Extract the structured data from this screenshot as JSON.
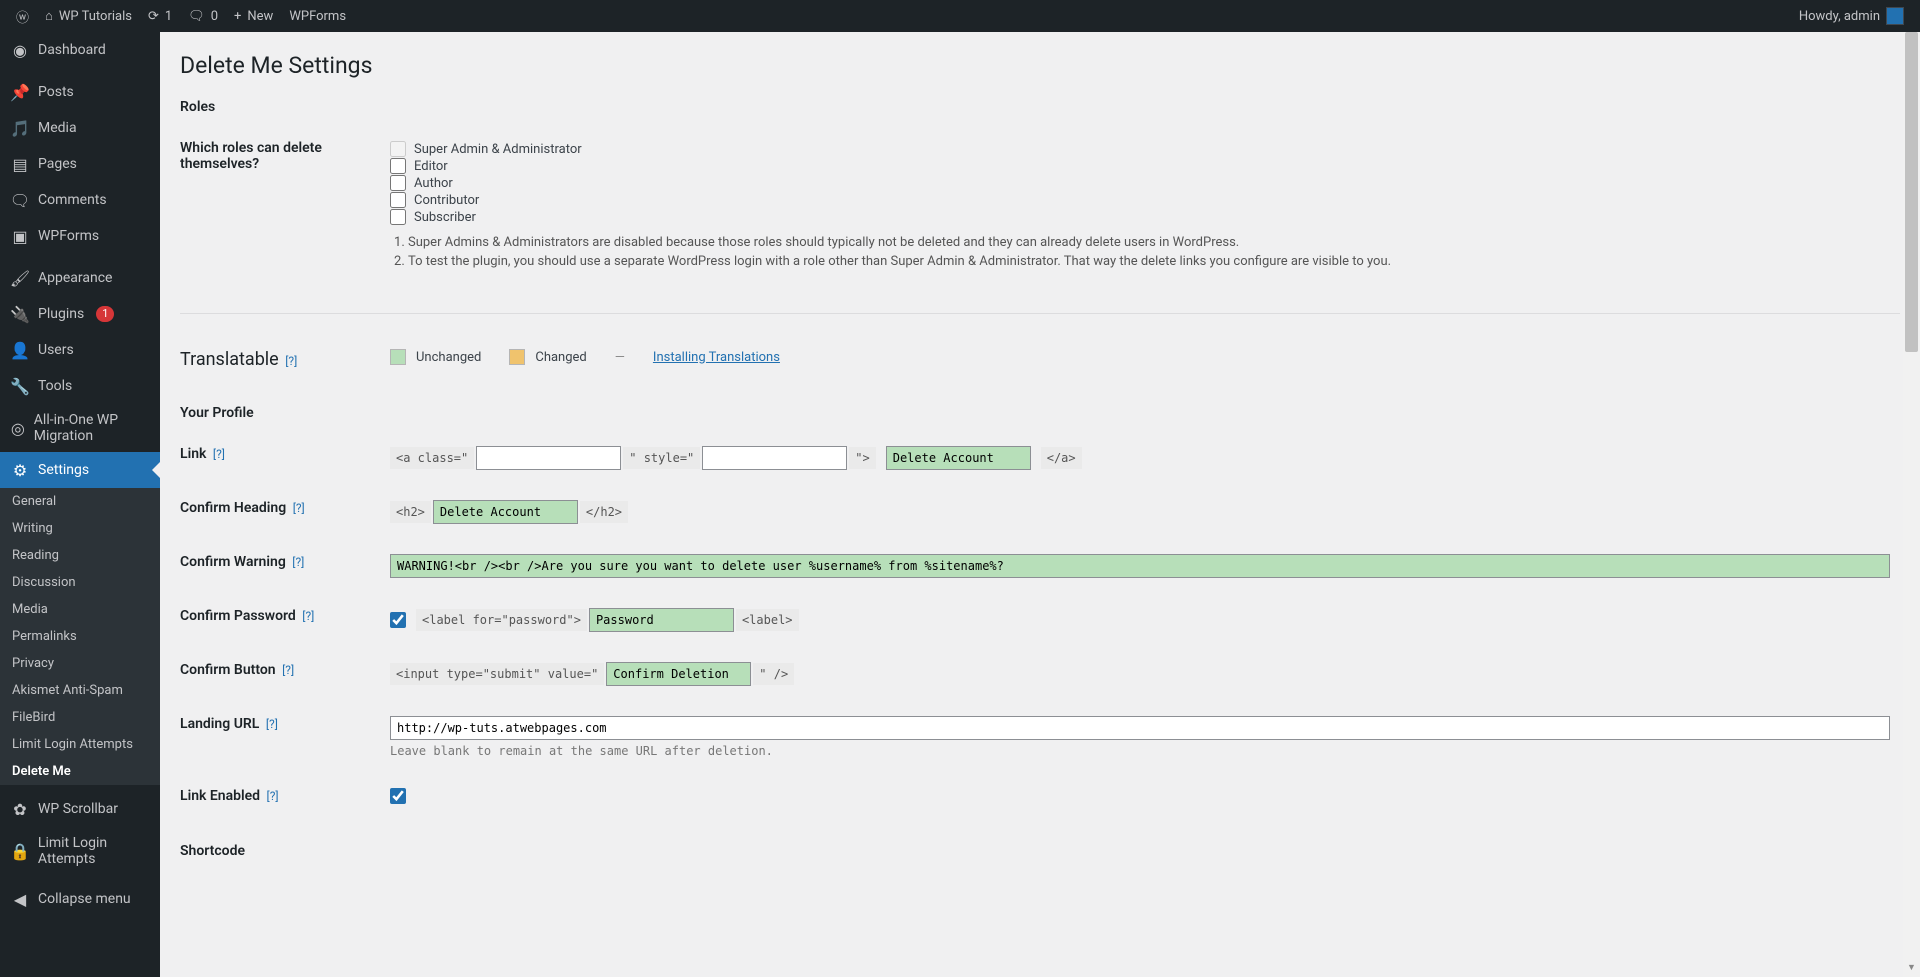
{
  "adminbar": {
    "site": "WP Tutorials",
    "updates": "1",
    "comments": "0",
    "new": "New",
    "wpforms": "WPForms",
    "howdy": "Howdy, admin"
  },
  "sidebar": {
    "dashboard": "Dashboard",
    "posts": "Posts",
    "media": "Media",
    "pages": "Pages",
    "comments": "Comments",
    "wpforms": "WPForms",
    "appearance": "Appearance",
    "plugins": "Plugins",
    "plugins_badge": "1",
    "users": "Users",
    "tools": "Tools",
    "aio": "All-in-One WP Migration",
    "settings": "Settings",
    "sub": {
      "general": "General",
      "writing": "Writing",
      "reading": "Reading",
      "discussion": "Discussion",
      "media": "Media",
      "permalinks": "Permalinks",
      "privacy": "Privacy",
      "akismet": "Akismet Anti-Spam",
      "filebird": "FileBird",
      "lla": "Limit Login Attempts",
      "deleteme": "Delete Me"
    },
    "wpscrollbar": "WP Scrollbar",
    "limitlogin": "Limit Login Attempts",
    "collapse": "Collapse menu"
  },
  "page": {
    "title": "Delete Me Settings"
  },
  "roles": {
    "heading": "Roles",
    "label": "Which roles can delete themselves?",
    "items": [
      "Super Admin & Administrator",
      "Editor",
      "Author",
      "Contributor",
      "Subscriber"
    ],
    "note1": "Super Admins & Administrators are disabled because those roles should typically not be deleted and they can already delete users in WordPress.",
    "note2": "To test the plugin, you should use a separate WordPress login with a role other than Super Admin & Administrator. That way the delete links you configure are visible to you."
  },
  "translatable": {
    "heading": "Translatable",
    "help": "[?]",
    "unchanged": "Unchanged",
    "changed": "Changed",
    "dash": "—",
    "install": "Installing Translations"
  },
  "profile": {
    "heading": "Your Profile",
    "rows": {
      "link": {
        "label": "Link",
        "help": "[?]",
        "prefix": "<a class=\"",
        "mid1": "\" style=\"",
        "mid2": "\">",
        "text": "Delete Account",
        "suffix": "</a>",
        "class_val": "",
        "style_val": ""
      },
      "confirm_heading": {
        "label": "Confirm Heading",
        "help": "[?]",
        "prefix": "<h2>",
        "value": "Delete Account",
        "suffix": "</h2>"
      },
      "confirm_warning": {
        "label": "Confirm Warning",
        "help": "[?]",
        "value": "WARNING!<br /><br />Are you sure you want to delete user %username% from %sitename%?"
      },
      "confirm_password": {
        "label": "Confirm Password",
        "help": "[?]",
        "checked": true,
        "prefix": "<label for=\"password\">",
        "value": "Password",
        "suffix": "<label>"
      },
      "confirm_button": {
        "label": "Confirm Button",
        "help": "[?]",
        "prefix": "<input type=\"submit\" value=\"",
        "value": "Confirm Deletion",
        "suffix": "\" />"
      },
      "landing_url": {
        "label": "Landing URL",
        "help": "[?]",
        "value": "http://wp-tuts.atwebpages.com",
        "desc": "Leave blank to remain at the same URL after deletion."
      },
      "link_enabled": {
        "label": "Link Enabled",
        "help": "[?]",
        "checked": true
      }
    }
  },
  "shortcode": {
    "heading": "Shortcode"
  }
}
